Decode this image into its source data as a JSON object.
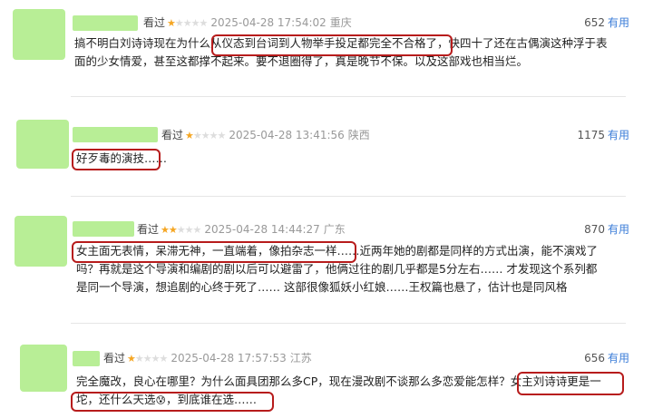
{
  "reviews": [
    {
      "seen": "看过",
      "stars_filled": 1,
      "stars": "★",
      "stars_empty": "★★★★",
      "date": "2025-04-28 17:54:02",
      "location": "重庆",
      "useful_count": "652",
      "useful_label": "有用",
      "lines": [
        "搞不明白刘诗诗现在为什么从仪态到台词到人物举手投足都完全不合格了，快四十了还在古偶演这种浮于表",
        "面的少女情爱，甚至这都撑不起来。要不退圈得了，真是晚节不保。以及这部戏也相当烂。"
      ]
    },
    {
      "seen": "看过",
      "stars_filled": 1,
      "stars": "★",
      "stars_empty": "★★★★",
      "date": "2025-04-28 13:41:56",
      "location": "陕西",
      "useful_count": "1175",
      "useful_label": "有用",
      "lines": [
        "好歹毒的演技……"
      ]
    },
    {
      "seen": "看过",
      "stars_filled": 2,
      "stars": "★★",
      "stars_empty": "★★★",
      "date": "2025-04-28 14:44:27",
      "location": "广东",
      "useful_count": "870",
      "useful_label": "有用",
      "lines": [
        "女主面无表情，呆滞无神，一直端着，像拍杂志一样……近两年她的剧都是同样的方式出演，能不演戏了",
        "吗？再就是这个导演和编剧的剧以后可以避雷了，他俩过往的剧几乎都是5分左右…… 才发现这个系列都",
        "是同一个导演，想追剧的心终于死了…… 这部很像狐妖小红娘……王权篇也悬了，估计也是同风格"
      ]
    },
    {
      "seen": "看过",
      "stars_filled": 1,
      "stars": "★",
      "stars_empty": "★★★★",
      "date": "2025-04-28 17:57:53",
      "location": "江苏",
      "useful_count": "656",
      "useful_label": "有用",
      "lines": [
        "完全魔改，良心在哪里？为什么面具团那么多CP，现在漫改剧不谈那么多恋爱能怎样？女主刘诗诗更是一",
        "坨，还什么天选",
        "，到底谁在选……"
      ],
      "emoji": "😰"
    }
  ]
}
